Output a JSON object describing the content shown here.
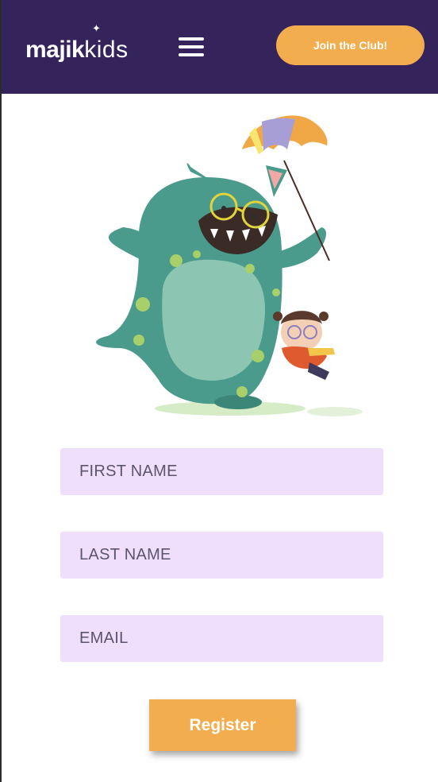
{
  "header": {
    "logo_bold": "majik",
    "logo_thin": "kids",
    "join_label": "Join the Club!"
  },
  "form": {
    "first_name_placeholder": "FIRST NAME",
    "last_name_placeholder": "LAST NAME",
    "email_placeholder": "EMAIL",
    "register_label": "Register"
  },
  "colors": {
    "header_bg": "#35235c",
    "accent": "#f2ad4e",
    "field_bg": "#efdffc"
  }
}
